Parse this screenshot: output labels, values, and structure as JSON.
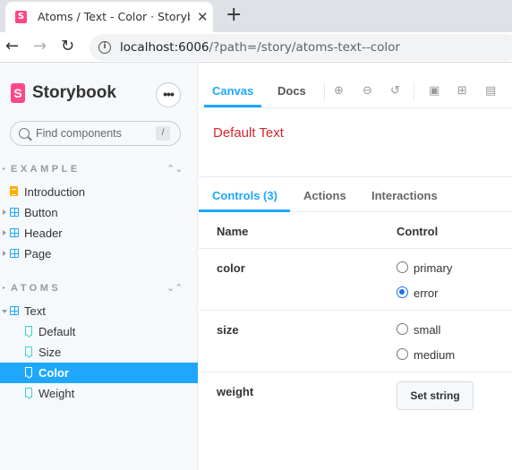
{
  "browser": {
    "tab_title": "Atoms / Text - Color · Storybook",
    "tab_close": "✕",
    "new_tab": "+",
    "url_host": "localhost:6006",
    "url_path": "/?path=/story/atoms-text--color",
    "favicon": "S"
  },
  "sidebar": {
    "brand": "Storybook",
    "logo_letter": "S",
    "menu_dots": "•••",
    "search_placeholder": "Find components",
    "search_shortcut": "/",
    "groups": [
      {
        "label": "EXAMPLE",
        "toggle": "⌃",
        "items": [
          {
            "label": "Introduction",
            "icon": "doc-icon"
          },
          {
            "label": "Button",
            "icon": "component-icon"
          },
          {
            "label": "Header",
            "icon": "component-icon"
          },
          {
            "label": "Page",
            "icon": "component-icon"
          }
        ]
      },
      {
        "label": "ATOMS",
        "toggle": "⌄",
        "items": [
          {
            "label": "Text",
            "icon": "component-icon"
          },
          {
            "label": "Default",
            "icon": "bookmark-icon"
          },
          {
            "label": "Size",
            "icon": "bookmark-icon"
          },
          {
            "label": "Color",
            "icon": "bookmark-icon",
            "selected": true
          },
          {
            "label": "Weight",
            "icon": "bookmark-icon"
          }
        ]
      }
    ]
  },
  "toolbar": {
    "tabs": [
      "Canvas",
      "Docs"
    ],
    "active_tab": "Canvas"
  },
  "preview": {
    "text": "Default Text",
    "text_color": "#d6262b"
  },
  "addons": {
    "tabs": [
      "Controls (3)",
      "Actions",
      "Interactions"
    ],
    "active_tab": "Controls (3)"
  },
  "controls": {
    "headers": {
      "name": "Name",
      "control": "Control"
    },
    "rows": [
      {
        "name": "color",
        "options": [
          "primary",
          "error"
        ],
        "selected": "error"
      },
      {
        "name": "size",
        "options": [
          "small",
          "medium"
        ],
        "selected": null
      },
      {
        "name": "weight",
        "button": "Set string"
      }
    ]
  },
  "colors": {
    "accent": "#1ea7fd",
    "brand": "#ff4785"
  }
}
